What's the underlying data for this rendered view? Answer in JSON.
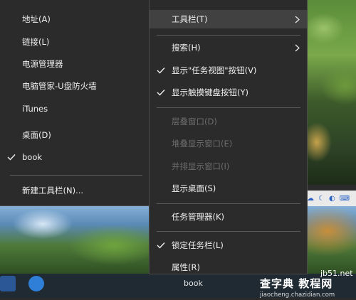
{
  "left_menu": {
    "items": [
      {
        "label": "地址(A)",
        "checked": false
      },
      {
        "label": "链接(L)",
        "checked": false
      },
      {
        "label": "电源管理器",
        "checked": false
      },
      {
        "label": "电脑管家-U盘防火墙",
        "checked": false
      },
      {
        "label": "iTunes",
        "checked": false
      },
      {
        "label": "桌面(D)",
        "checked": false
      },
      {
        "label": "book",
        "checked": true
      },
      {
        "label": "新建工具栏(N)...",
        "checked": false
      }
    ]
  },
  "right_menu": {
    "items": [
      {
        "label": "工具栏(T)",
        "submenu": true,
        "highlighted": true
      },
      {
        "label": "搜索(H)",
        "submenu": true
      },
      {
        "label": "显示\"任务视图\"按钮(V)",
        "checked": true
      },
      {
        "label": "显示触摸键盘按钮(Y)",
        "checked": true
      },
      {
        "label": "层叠窗口(D)",
        "disabled": true
      },
      {
        "label": "堆叠显示窗口(E)",
        "disabled": true
      },
      {
        "label": "并排显示窗口(I)",
        "disabled": true
      },
      {
        "label": "显示桌面(S)"
      },
      {
        "label": "任务管理器(K)"
      },
      {
        "label": "锁定任务栏(L)",
        "checked": true
      },
      {
        "label": "属性(R)"
      }
    ]
  },
  "taskbar": {
    "visible_text": "book"
  },
  "watermark": {
    "line1": "jb51.net",
    "line2": "查字典 教程网",
    "line3": "jiaocheng.chazidian.com"
  },
  "colors": {
    "menu_bg": "#2b2b2b",
    "menu_border": "#4a4a4a",
    "highlight": "#414141",
    "text": "#f0f0f0",
    "disabled_text": "#6d6d6d"
  }
}
